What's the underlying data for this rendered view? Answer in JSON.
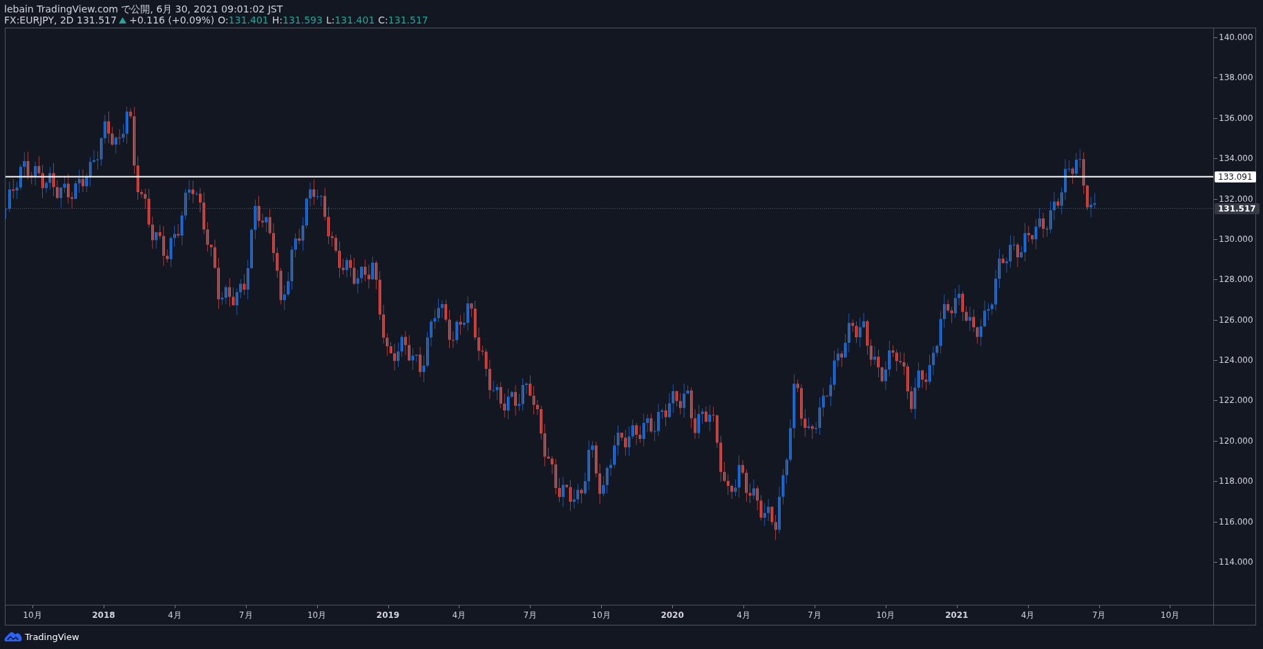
{
  "header": {
    "published": "lebain TradingView.com で公開, 6月 30, 2021 09:01:02 JST"
  },
  "legend": {
    "symbol": "FX:EURJPY, 2D 131.517",
    "rising": true,
    "change": "+0.116 (+0.09%)",
    "ohlc": [
      {
        "label": "O:",
        "value": "131.401"
      },
      {
        "label": "H:",
        "value": "131.593"
      },
      {
        "label": "L:",
        "value": "131.401"
      },
      {
        "label": "C:",
        "value": "131.517"
      }
    ]
  },
  "price_axis": {
    "labels": [
      "140.000",
      "138.000",
      "136.000",
      "134.000",
      "132.000",
      "130.000",
      "128.000",
      "126.000",
      "124.000",
      "122.000",
      "120.000",
      "118.000",
      "116.000",
      "114.000"
    ],
    "line_label": "133.091",
    "last_price": "131.517"
  },
  "time_axis": {
    "labels": [
      {
        "text": "10月",
        "kind": "month"
      },
      {
        "text": "2018",
        "kind": "year"
      },
      {
        "text": "4月",
        "kind": "month"
      },
      {
        "text": "7月",
        "kind": "month"
      },
      {
        "text": "10月",
        "kind": "month"
      },
      {
        "text": "2019",
        "kind": "year"
      },
      {
        "text": "4月",
        "kind": "month"
      },
      {
        "text": "7月",
        "kind": "month"
      },
      {
        "text": "10月",
        "kind": "month"
      },
      {
        "text": "2020",
        "kind": "year"
      },
      {
        "text": "4月",
        "kind": "month"
      },
      {
        "text": "7月",
        "kind": "month"
      },
      {
        "text": "10月",
        "kind": "month"
      },
      {
        "text": "2021",
        "kind": "year"
      },
      {
        "text": "4月",
        "kind": "month"
      },
      {
        "text": "7月",
        "kind": "month"
      },
      {
        "text": "10月",
        "kind": "month"
      }
    ]
  },
  "footer": {
    "brand": "TradingView"
  }
}
